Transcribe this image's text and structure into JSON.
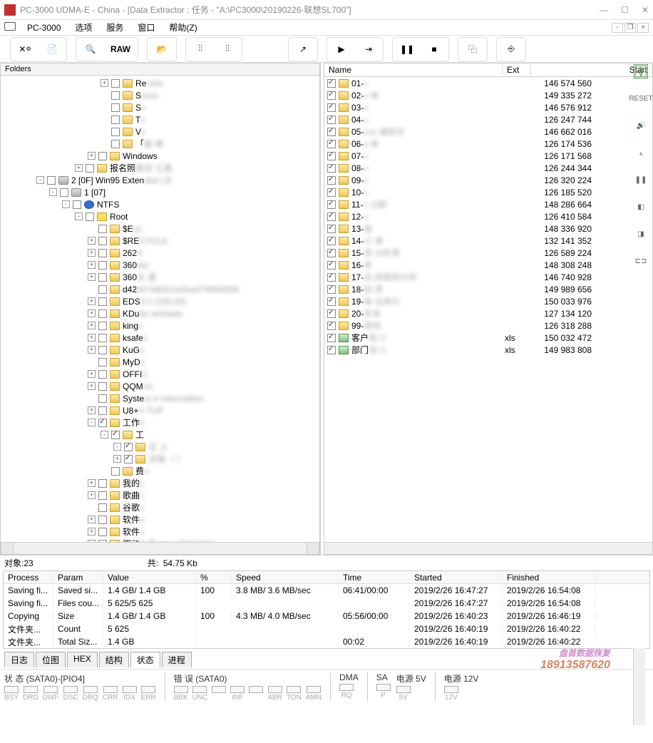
{
  "titlebar": {
    "text": "PC-3000 UDMA-E - China - [Data Extractor : 任务 - \"A:\\PC3000\\20190226-联想SL700\"]"
  },
  "menubar": {
    "app": "PC-3000",
    "items": [
      "选项",
      "服务",
      "窗口",
      "帮助(Z)"
    ]
  },
  "toolbar": {
    "raw": "RAW"
  },
  "left_panel": {
    "header": "Folders",
    "tree": [
      {
        "indent": 140,
        "exp": "+",
        "chk": false,
        "icon": "fld",
        "label": "Re",
        "blur": "cent"
      },
      {
        "indent": 140,
        "exp": "",
        "chk": false,
        "icon": "fld",
        "label": "S",
        "blur": "xxxs"
      },
      {
        "indent": 140,
        "exp": "",
        "chk": false,
        "icon": "fld",
        "label": "S",
        "blur": "x"
      },
      {
        "indent": 140,
        "exp": "",
        "chk": false,
        "icon": "fld",
        "label": "T",
        "blur": "x"
      },
      {
        "indent": 140,
        "exp": "",
        "chk": false,
        "icon": "fld",
        "label": "V",
        "blur": "x"
      },
      {
        "indent": 140,
        "exp": "",
        "chk": false,
        "icon": "fld",
        "label": "「",
        "blur": "始   单"
      },
      {
        "indent": 122,
        "exp": "+",
        "chk": false,
        "icon": "fld",
        "label": "Windows",
        "blur": ""
      },
      {
        "indent": 104,
        "exp": "+",
        "chk": false,
        "icon": "fld",
        "label": "报名照",
        "blur": "   核对  工具"
      },
      {
        "indent": 50,
        "exp": "-",
        "chk": false,
        "icon": "drive",
        "label": "2 [0F] Win95 Exten",
        "blur": "ded LB"
      },
      {
        "indent": 68,
        "exp": "-",
        "chk": false,
        "icon": "drive",
        "label": "1 [07]",
        "blur": ""
      },
      {
        "indent": 86,
        "exp": "-",
        "chk": false,
        "icon": "ntfs",
        "label": "NTFS",
        "blur": ""
      },
      {
        "indent": 104,
        "exp": "-",
        "chk": false,
        "icon": "root",
        "label": "Root",
        "blur": ""
      },
      {
        "indent": 122,
        "exp": "",
        "chk": false,
        "icon": "fld",
        "label": "$E",
        "blur": "xx"
      },
      {
        "indent": 122,
        "exp": "+",
        "chk": false,
        "icon": "fld",
        "label": "$RE",
        "blur": "CYCLE"
      },
      {
        "indent": 122,
        "exp": "+",
        "chk": false,
        "icon": "fld",
        "label": "262",
        "blur": "   3"
      },
      {
        "indent": 122,
        "exp": "+",
        "chk": false,
        "icon": "fld",
        "label": "360",
        "blur": "nlo"
      },
      {
        "indent": 122,
        "exp": "+",
        "chk": false,
        "icon": "fld",
        "label": "360",
        "blur": "   大   录"
      },
      {
        "indent": 122,
        "exp": "",
        "chk": false,
        "icon": "fld",
        "label": "d42",
        "blur": "b0   0d6311e0aa379004008"
      },
      {
        "indent": 122,
        "exp": "+",
        "chk": false,
        "icon": "fld",
        "label": "EDS",
        "blur": "3.2   (100.50)"
      },
      {
        "indent": 122,
        "exp": "+",
        "chk": false,
        "icon": "fld",
        "label": "KDu",
        "blur": "bo   wnloads"
      },
      {
        "indent": 122,
        "exp": "+",
        "chk": false,
        "icon": "fld",
        "label": "king",
        "blur": "x"
      },
      {
        "indent": 122,
        "exp": "+",
        "chk": false,
        "icon": "fld",
        "label": "ksafe",
        "blur": "x"
      },
      {
        "indent": 122,
        "exp": "+",
        "chk": false,
        "icon": "fld",
        "label": "KuG",
        "blur": "x"
      },
      {
        "indent": 122,
        "exp": "",
        "chk": false,
        "icon": "fld",
        "label": "MyD",
        "blur": "x"
      },
      {
        "indent": 122,
        "exp": "+",
        "chk": false,
        "icon": "fld",
        "label": "OFFI",
        "blur": "C"
      },
      {
        "indent": 122,
        "exp": "+",
        "chk": false,
        "icon": "fld",
        "label": "QQM",
        "blur": "   ne"
      },
      {
        "indent": 122,
        "exp": "",
        "chk": false,
        "icon": "fld",
        "label": "Syste",
        "blur": "m   e Information"
      },
      {
        "indent": 122,
        "exp": "+",
        "chk": false,
        "icon": "fld",
        "label": "U8+",
        "blur": "V   TUP"
      },
      {
        "indent": 122,
        "exp": "-",
        "chk": true,
        "icon": "fld",
        "label": "工作",
        "blur": "x"
      },
      {
        "indent": 140,
        "exp": "-",
        "chk": true,
        "icon": "fld",
        "label": "工",
        "blur": ""
      },
      {
        "indent": 158,
        "exp": "-",
        "chk": true,
        "icon": "fld",
        "label": "",
        "blur": "   文   上"
      },
      {
        "indent": 158,
        "exp": "+",
        "chk": true,
        "icon": "fld",
        "label": "",
        "blur": "   文档（   ）"
      },
      {
        "indent": 140,
        "exp": "",
        "chk": false,
        "icon": "fld",
        "label": "费",
        "blur": "x"
      },
      {
        "indent": 122,
        "exp": "+",
        "chk": false,
        "icon": "fld",
        "label": "我的",
        "blur": "x"
      },
      {
        "indent": 122,
        "exp": "+",
        "chk": false,
        "icon": "fld",
        "label": "歌曲",
        "blur": "x"
      },
      {
        "indent": 122,
        "exp": "",
        "chk": false,
        "icon": "fld",
        "label": "谷歌",
        "blur": "x"
      },
      {
        "indent": 122,
        "exp": "+",
        "chk": false,
        "icon": "fld",
        "label": "软件",
        "blur": "x"
      },
      {
        "indent": 122,
        "exp": "+",
        "chk": false,
        "icon": "fld",
        "label": "软件",
        "blur": "x"
      },
      {
        "indent": 122,
        "exp": "+",
        "chk": false,
        "icon": "fld",
        "label": "驱动",
        "blur": "   P   系   nsx_20161124"
      }
    ]
  },
  "right_panel": {
    "headers": {
      "name": "Name",
      "ext": "Ext",
      "start": "Start"
    },
    "rows": [
      {
        "icon": "fld",
        "name": "01-",
        "blur": "x",
        "ext": "",
        "start": "146 574 560"
      },
      {
        "icon": "fld",
        "name": "02-",
        "blur": "x   单",
        "ext": "",
        "start": "149 335 272"
      },
      {
        "icon": "fld",
        "name": "03-",
        "blur": "x",
        "ext": "",
        "start": "146 576 912"
      },
      {
        "icon": "fld",
        "name": "04-",
        "blur": "x",
        "ext": "",
        "start": "126 247 744"
      },
      {
        "icon": "fld",
        "name": "05-",
        "blur": "xxx   端核对",
        "ext": "",
        "start": "146 662 016"
      },
      {
        "icon": "fld",
        "name": "06-",
        "blur": "x   单",
        "ext": "",
        "start": "126 174 536"
      },
      {
        "icon": "fld",
        "name": "07-",
        "blur": "x",
        "ext": "",
        "start": "126 171 568"
      },
      {
        "icon": "fld",
        "name": "08-",
        "blur": "x",
        "ext": "",
        "start": "126 244 344"
      },
      {
        "icon": "fld",
        "name": "09-",
        "blur": "x",
        "ext": "",
        "start": "126 320 224"
      },
      {
        "icon": "fld",
        "name": "10-",
        "blur": "x",
        "ext": "",
        "start": "126 185 520"
      },
      {
        "icon": "fld",
        "name": "11-",
        "blur": "x   分配",
        "ext": "",
        "start": "148 286 664"
      },
      {
        "icon": "fld",
        "name": "12-",
        "blur": "x",
        "ext": "",
        "start": "126 410 584"
      },
      {
        "icon": "fld",
        "name": "13-",
        "blur": "盘",
        "ext": "",
        "start": "148 336 920"
      },
      {
        "icon": "fld",
        "name": "14-",
        "blur": "订   单",
        "ext": "",
        "start": "132 141 352"
      },
      {
        "icon": "fld",
        "name": "15-",
        "blur": "营   分析表",
        "ext": "",
        "start": "126 589 224"
      },
      {
        "icon": "fld",
        "name": "16-",
        "blur": "考",
        "ext": "",
        "start": "148 308 248"
      },
      {
        "icon": "fld",
        "name": "17-",
        "blur": "应   款账龄分析",
        "ext": "",
        "start": "146 740 928"
      },
      {
        "icon": "fld",
        "name": "18-",
        "blur": "回   表",
        "ext": "",
        "start": "149 989 656"
      },
      {
        "icon": "fld",
        "name": "19-",
        "blur": "每   出库价",
        "ext": "",
        "start": "150 033 976"
      },
      {
        "icon": "fld",
        "name": "20-",
        "blur": "年末",
        "ext": "",
        "start": "127 134 120"
      },
      {
        "icon": "fld",
        "name": "99-",
        "blur": "其他",
        "ext": "",
        "start": "126 318 288"
      },
      {
        "icon": "xls",
        "name": "客户",
        "blur": "档   S",
        "ext": "xls",
        "start": "150 032 472"
      },
      {
        "icon": "xls",
        "name": "部门",
        "blur": "档   S",
        "ext": "xls",
        "start": "149 983 808"
      }
    ]
  },
  "status": {
    "objects_label": "对象:",
    "objects_value": "23",
    "total_label": "共:",
    "total_value": "54.75 Kb"
  },
  "progress": {
    "headers": {
      "process": "Process",
      "param": "Param",
      "value": "Value",
      "pct": "%",
      "speed": "Speed",
      "time": "Time",
      "started": "Started",
      "finished": "Finished"
    },
    "rows": [
      {
        "process": "Saving fi...",
        "param": "Saved si...",
        "value": "1.4 GB/ 1.4 GB",
        "pct": "100",
        "speed": "3.8 MB/ 3.6 MB/sec",
        "time": "06:41/00:00",
        "started": "2019/2/26 16:47:27",
        "finished": "2019/2/26 16:54:08"
      },
      {
        "process": "Saving fi...",
        "param": "Files cou...",
        "value": "5 625/5 625",
        "pct": "",
        "speed": "",
        "time": "",
        "started": "2019/2/26 16:47:27",
        "finished": "2019/2/26 16:54:08"
      },
      {
        "process": "Copying",
        "param": "Size",
        "value": "1.4 GB/ 1.4 GB",
        "pct": "100",
        "speed": "4.3 MB/ 4.0 MB/sec",
        "time": "05:56/00:00",
        "started": "2019/2/26 16:40:23",
        "finished": "2019/2/26 16:46:19"
      },
      {
        "process": "文件夹...",
        "param": "Count",
        "value": "5 625",
        "pct": "",
        "speed": "",
        "time": "",
        "started": "2019/2/26 16:40:19",
        "finished": "2019/2/26 16:40:22"
      },
      {
        "process": "文件夹...",
        "param": "Total Siz...",
        "value": "1.4 GB",
        "pct": "",
        "speed": "",
        "time": "00:02",
        "started": "2019/2/26 16:40:19",
        "finished": "2019/2/26 16:40:22"
      }
    ]
  },
  "tabs": [
    "日志",
    "位图",
    "HEX",
    "结构",
    "状态",
    "进程"
  ],
  "active_tab": 4,
  "bottom": {
    "state_label": "状 态 (SATA0)-[PIO4]",
    "state_leds": [
      "BSY",
      "DRD",
      "DWF",
      "DSC",
      "DRQ",
      "CRR",
      "IDX",
      "ERR"
    ],
    "error_label": "错 误 (SATA0)",
    "error_leds": [
      "BBK",
      "UNC",
      "",
      "INF",
      "",
      "ABR",
      "TON",
      "AMN"
    ],
    "dma_label": "DMA",
    "dma_leds": [
      "RQ"
    ],
    "sa_label": "SA",
    "sa_leds": [
      "P"
    ],
    "pwr5_label": "电源 5V",
    "pwr5_leds": [
      "5V"
    ],
    "pwr12_label": "电源 12V",
    "pwr12_leds": [
      "12V"
    ]
  },
  "watermark": {
    "text": "盘首数据恢复",
    "phone": "18913587620"
  }
}
